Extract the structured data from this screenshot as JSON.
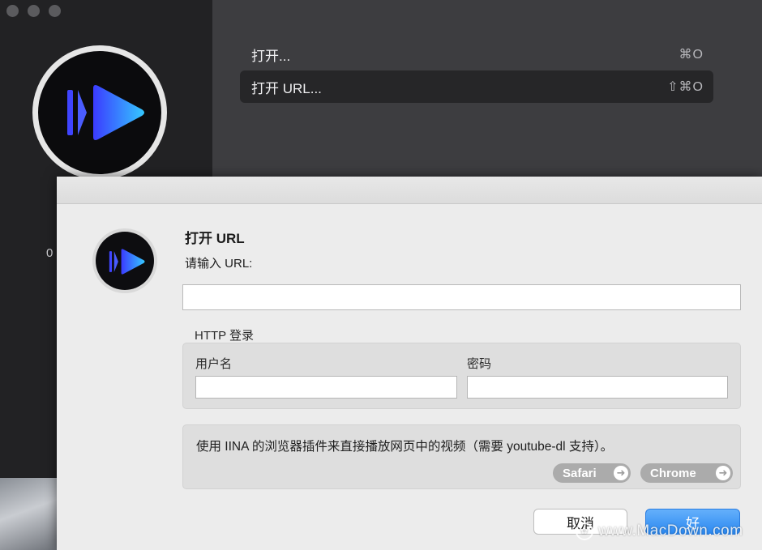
{
  "background_window": {
    "version_fragment": "0",
    "menu": [
      {
        "label": "打开...",
        "shortcut": "⌘O",
        "selected": false
      },
      {
        "label": "打开 URL...",
        "shortcut": "⇧⌘O",
        "selected": true
      }
    ]
  },
  "dialog": {
    "title": "打开 URL",
    "prompt": "请输入 URL:",
    "url_value": "",
    "http_login": {
      "label": "HTTP 登录",
      "username_label": "用户名",
      "username_value": "",
      "password_label": "密码",
      "password_value": ""
    },
    "plugin": {
      "text": "使用 IINA 的浏览器插件来直接播放网页中的视频（需要 youtube-dl 支持）。",
      "safari_label": "Safari",
      "chrome_label": "Chrome"
    },
    "buttons": {
      "cancel": "取消",
      "ok": "好"
    }
  },
  "watermark": "www.MacDown.com",
  "colors": {
    "accent": "#2b88f0",
    "logo_gradient_start": "#3b3bff",
    "logo_gradient_end": "#35c8ff"
  }
}
